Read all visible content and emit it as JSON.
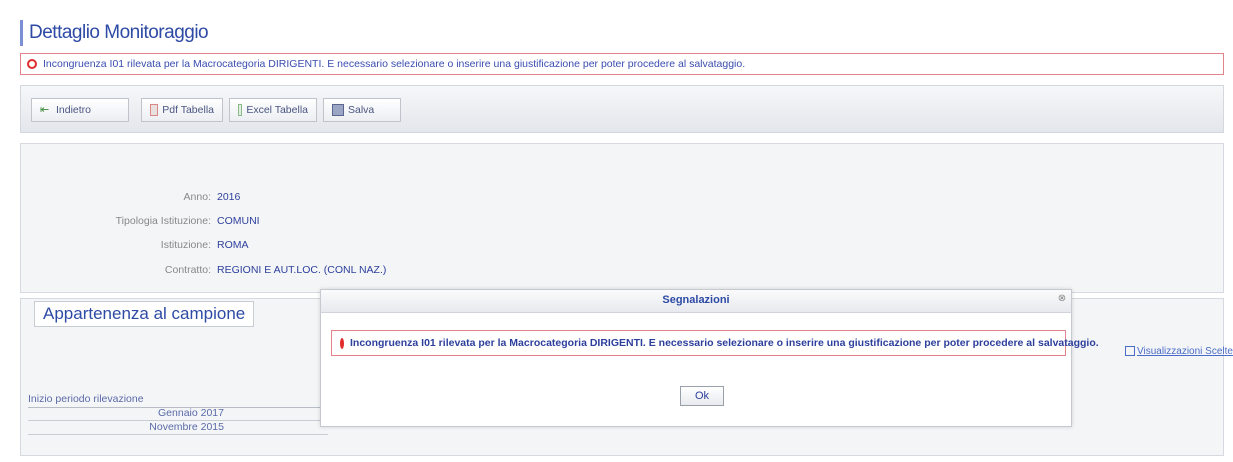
{
  "page": {
    "title": "Dettaglio Monitoraggio",
    "alert_text": "Incongruenza I01 rilevata per la Macrocategoria DIRIGENTI. E necessario selezionare o inserire una giustificazione per poter procedere al salvataggio."
  },
  "toolbar": {
    "back_label": "Indietro",
    "pdf_label": "Pdf Tabella",
    "excel_label": "Excel Tabella",
    "save_label": "Salva"
  },
  "info": {
    "anno_label": "Anno:",
    "anno_value": "2016",
    "tipologia_label": "Tipologia Istituzione:",
    "tipologia_value": "COMUNI",
    "istituzione_label": "Istituzione:",
    "istituzione_value": "ROMA",
    "contratto_label": "Contratto:",
    "contratto_value": "REGIONI E AUT.LOC. (CONL NAZ.)"
  },
  "section": {
    "title": "Appartenenza al campione",
    "link_text": "Visualizzazioni Scelte",
    "table_header": "Inizio periodo rilevazione",
    "rows": [
      "Gennaio 2017",
      "Novembre 2015"
    ]
  },
  "modal": {
    "title": "Segnalazioni",
    "close_symbol": "⊗",
    "message": "Incongruenza I01 rilevata per la Macrocategoria DIRIGENTI. E necessario selezionare o inserire una giustificazione per poter procedere al salvataggio.",
    "ok_label": "Ok"
  }
}
